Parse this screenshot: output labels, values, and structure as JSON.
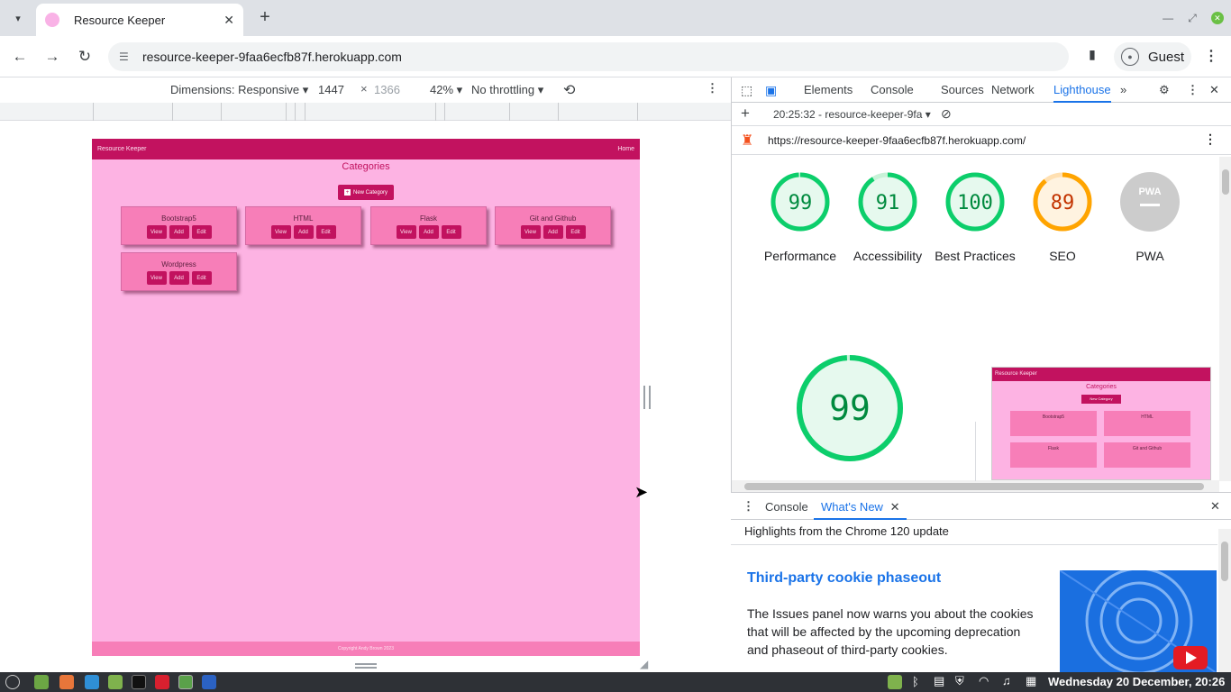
{
  "browser": {
    "tab_title": "Resource Keeper",
    "url": "resource-keeper-9faa6ecfb87f.herokuapp.com",
    "profile_label": "Guest"
  },
  "device_toolbar": {
    "dimensions_label": "Dimensions: Responsive",
    "width": "1447",
    "height": "1366",
    "zoom": "42%",
    "throttling": "No throttling"
  },
  "site": {
    "brand": "Resource Keeper",
    "nav_home": "Home",
    "page_title": "Categories",
    "new_category_label": "New Category",
    "button_view": "View",
    "button_add": "Add",
    "button_edit": "Edit",
    "categories": [
      "Bootstrap5",
      "HTML",
      "Flask",
      "Git and Github",
      "Wordpress"
    ],
    "footer": "Copyright Andy Brown 2023"
  },
  "devtools": {
    "tabs": [
      "Elements",
      "Console",
      "Sources",
      "Network",
      "Lighthouse"
    ],
    "active_tab": "Lighthouse",
    "report_label": "20:25:32 - resource-keeper-9fa",
    "report_url": "https://resource-keeper-9faa6ecfb87f.herokuapp.com/",
    "scores": [
      {
        "label": "Performance",
        "value": "99",
        "color": "#0cce6b"
      },
      {
        "label": "Accessibility",
        "value": "91",
        "color": "#0cce6b"
      },
      {
        "label": "Best Practices",
        "value": "100",
        "color": "#0cce6b"
      },
      {
        "label": "SEO",
        "value": "89",
        "color": "#ffa400"
      },
      {
        "label": "PWA",
        "value": "PWA",
        "color": "#cccccc"
      }
    ],
    "big_score": "99",
    "thumb": {
      "brand": "Resource Keeper",
      "title": "Categories",
      "new_category": "New Category",
      "categories": [
        "Bootstrap5",
        "HTML",
        "Flask",
        "Git and Github"
      ]
    }
  },
  "drawer": {
    "tabs": [
      "Console",
      "What's New"
    ],
    "active_tab": "What's New",
    "subtitle": "Highlights from the Chrome 120 update",
    "headline": "Third-party cookie phaseout",
    "body": "The Issues panel now warns you about the cookies that will be affected by the upcoming deprecation and phaseout of third-party cookies."
  },
  "taskbar": {
    "clock": "Wednesday 20 December, 20:26"
  }
}
